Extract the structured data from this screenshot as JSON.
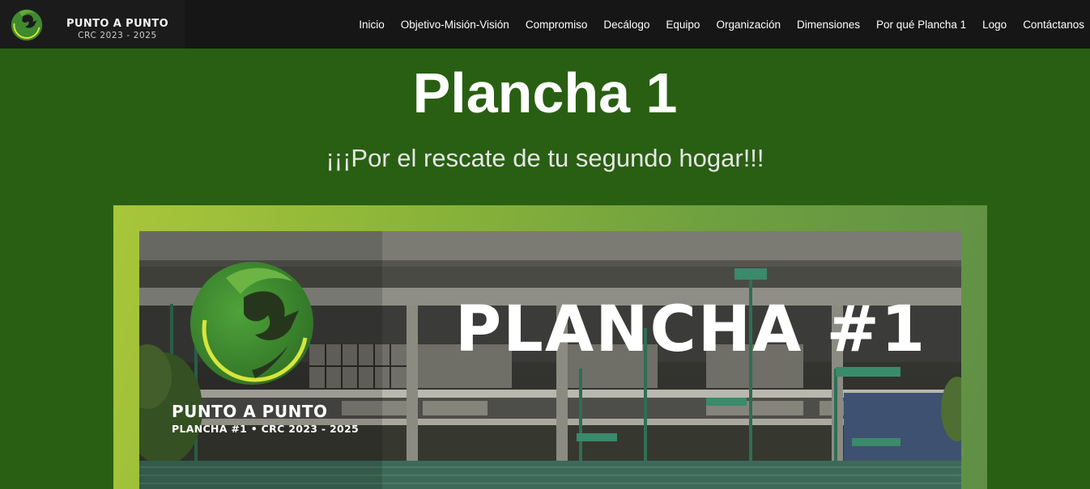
{
  "brand": {
    "title": "PUNTO A PUNTO",
    "subtitle": "CRC 2023 - 2025",
    "logo_icon": "phoenix-circle-logo"
  },
  "nav": {
    "items": [
      {
        "label": "Inicio"
      },
      {
        "label": "Objetivo-Misión-Visión"
      },
      {
        "label": "Compromiso"
      },
      {
        "label": "Decálogo"
      },
      {
        "label": "Equipo"
      },
      {
        "label": "Organización"
      },
      {
        "label": "Dimensiones"
      },
      {
        "label": "Por qué Plancha 1"
      },
      {
        "label": "Logo"
      },
      {
        "label": "Contáctanos"
      }
    ]
  },
  "hero": {
    "title": "Plancha 1",
    "subtitle": "¡¡¡Por el rescate de tu segundo hogar!!!"
  },
  "banner": {
    "headline": "PLANCHA #1",
    "brand": "PUNTO A PUNTO",
    "brand_sub": "PLANCHA #1 • CRC 2023 - 2025",
    "logo_icon": "phoenix-circle-logo",
    "photo_icon": "building-photo"
  },
  "colors": {
    "page_background": "#295f12",
    "navbar_background": "#161616",
    "logo_green": "#3f8a2e",
    "logo_accent_yellow": "#d7e63a",
    "banner_frame": "#a9c63a"
  }
}
